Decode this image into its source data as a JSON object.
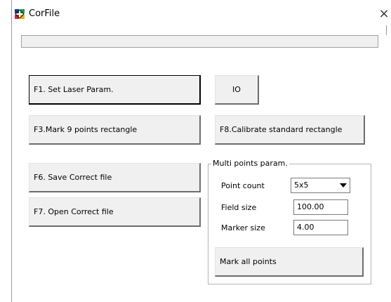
{
  "window": {
    "title": "CorFile",
    "close_glyph": "×"
  },
  "progress": {
    "value": 0
  },
  "buttons": {
    "f1": "F1. Set Laser Param.",
    "io": "IO",
    "f3": "F3.Mark 9 points rectangle",
    "f8": "F8.Calibrate standard rectangle",
    "f6": "F6. Save Correct file",
    "f7": "F7. Open Correct file"
  },
  "multi_points": {
    "group_label": "Multi points param.",
    "point_count_label": "Point count",
    "point_count_value": "5x5",
    "field_size_label": "Field size",
    "field_size_value": "100.00",
    "marker_size_label": "Marker size",
    "marker_size_value": "4.00",
    "mark_all_label": "Mark all points"
  },
  "icons": {
    "app": "app-icon",
    "close": "close-icon",
    "dropdown": "chevron-down-icon"
  },
  "colors": {
    "button_face": "#f0f0f0",
    "progress_fill": "#06b025"
  }
}
